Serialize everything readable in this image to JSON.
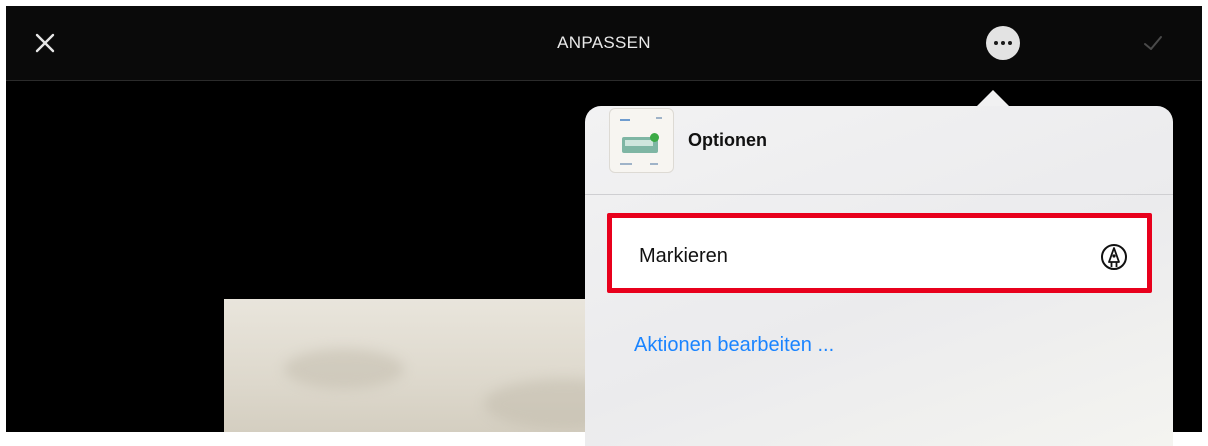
{
  "toolbar": {
    "title": "ANPASSEN",
    "close_icon": "close-icon",
    "more_icon": "more-icon",
    "confirm_icon": "checkmark-icon"
  },
  "popover": {
    "title": "Optionen",
    "thumbnail": "document-thumbnail",
    "items": [
      {
        "label": "Markieren",
        "icon": "markup-pen-icon"
      }
    ],
    "edit_actions_link": "Aktionen bearbeiten ..."
  },
  "colors": {
    "highlight_border": "#e8001c",
    "link": "#1a84ff",
    "background": "#000000",
    "popover": "#f0f0f2"
  }
}
